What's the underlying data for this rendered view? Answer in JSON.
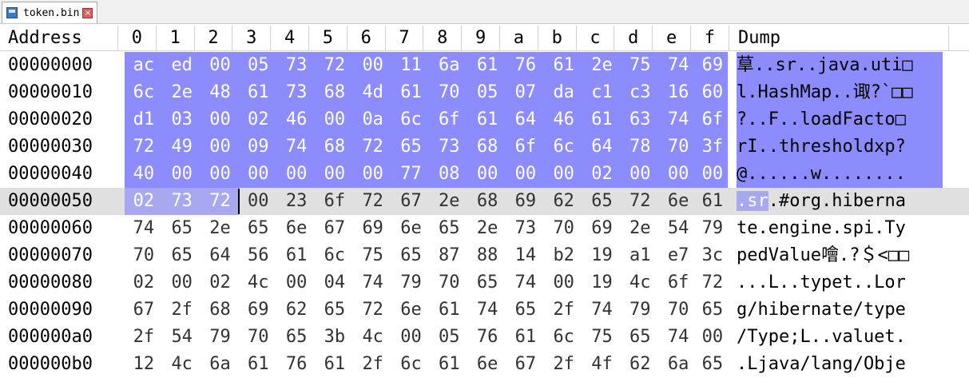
{
  "tab": {
    "label": "token.bin",
    "close_glyph": "×"
  },
  "header": {
    "address": "Address",
    "columns": [
      "0",
      "1",
      "2",
      "3",
      "4",
      "5",
      "6",
      "7",
      "8",
      "9",
      "a",
      "b",
      "c",
      "d",
      "e",
      "f"
    ],
    "dump": "Dump"
  },
  "rows": [
    {
      "address": "00000000",
      "bytes": [
        "ac",
        "ed",
        "00",
        "05",
        "73",
        "72",
        "00",
        "11",
        "6a",
        "61",
        "76",
        "61",
        "2e",
        "75",
        "74",
        "69"
      ],
      "dump": "䓍..sr..java.uti□"
    },
    {
      "address": "00000010",
      "bytes": [
        "6c",
        "2e",
        "48",
        "61",
        "73",
        "68",
        "4d",
        "61",
        "70",
        "05",
        "07",
        "da",
        "c1",
        "c3",
        "16",
        "60"
      ],
      "dump": "l.HashMap..诹?`□□"
    },
    {
      "address": "00000020",
      "bytes": [
        "d1",
        "03",
        "00",
        "02",
        "46",
        "00",
        "0a",
        "6c",
        "6f",
        "61",
        "64",
        "46",
        "61",
        "63",
        "74",
        "6f"
      ],
      "dump": "?..F..loadFacto□"
    },
    {
      "address": "00000030",
      "bytes": [
        "72",
        "49",
        "00",
        "09",
        "74",
        "68",
        "72",
        "65",
        "73",
        "68",
        "6f",
        "6c",
        "64",
        "78",
        "70",
        "3f"
      ],
      "dump": "rI..thresholdxp?"
    },
    {
      "address": "00000040",
      "bytes": [
        "40",
        "00",
        "00",
        "00",
        "00",
        "00",
        "00",
        "77",
        "08",
        "00",
        "00",
        "00",
        "02",
        "00",
        "00",
        "00"
      ],
      "dump": "@......w........"
    },
    {
      "address": "00000050",
      "bytes": [
        "02",
        "73",
        "72",
        "00",
        "23",
        "6f",
        "72",
        "67",
        "2e",
        "68",
        "69",
        "62",
        "65",
        "72",
        "6e",
        "61"
      ],
      "dump": ".sr.#org.hiberna"
    },
    {
      "address": "00000060",
      "bytes": [
        "74",
        "65",
        "2e",
        "65",
        "6e",
        "67",
        "69",
        "6e",
        "65",
        "2e",
        "73",
        "70",
        "69",
        "2e",
        "54",
        "79"
      ],
      "dump": "te.engine.spi.Ty"
    },
    {
      "address": "00000070",
      "bytes": [
        "70",
        "65",
        "64",
        "56",
        "61",
        "6c",
        "75",
        "65",
        "87",
        "88",
        "14",
        "b2",
        "19",
        "a1",
        "e7",
        "3c"
      ],
      "dump": "pedValue噲.?＄<□□"
    },
    {
      "address": "00000080",
      "bytes": [
        "02",
        "00",
        "02",
        "4c",
        "00",
        "04",
        "74",
        "79",
        "70",
        "65",
        "74",
        "00",
        "19",
        "4c",
        "6f",
        "72"
      ],
      "dump": "...L..typet..Lor"
    },
    {
      "address": "00000090",
      "bytes": [
        "67",
        "2f",
        "68",
        "69",
        "62",
        "65",
        "72",
        "6e",
        "61",
        "74",
        "65",
        "2f",
        "74",
        "79",
        "70",
        "65"
      ],
      "dump": "g/hibernate/type"
    },
    {
      "address": "000000a0",
      "bytes": [
        "2f",
        "54",
        "79",
        "70",
        "65",
        "3b",
        "4c",
        "00",
        "05",
        "76",
        "61",
        "6c",
        "75",
        "65",
        "74",
        "00"
      ],
      "dump": "/Type;L..valuet."
    },
    {
      "address": "000000b0",
      "bytes": [
        "12",
        "4c",
        "6a",
        "61",
        "76",
        "61",
        "2f",
        "6c",
        "61",
        "6e",
        "67",
        "2f",
        "4f",
        "62",
        "6a",
        "65"
      ],
      "dump": ".Ljava/lang/Obje"
    }
  ],
  "selection": {
    "full_rows": 5,
    "partial_row_bytes": 3,
    "current_row": 5
  },
  "colors": {
    "selection": "#8c8cff",
    "selection_light": "#a8a8f0",
    "current_row": "#e0e0e0"
  }
}
